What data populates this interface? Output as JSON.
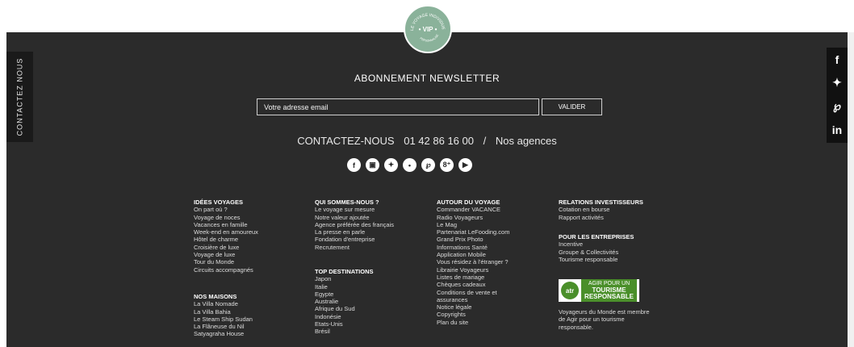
{
  "seal": {
    "arc_text": "LE VOYAGE INDIVIDUEL",
    "center": "• VIP •",
    "bottom_text": "PERSONNALISÉ"
  },
  "side_tab": {
    "label": "CONTACTEZ NOUS"
  },
  "social_bar": {
    "items": [
      {
        "glyph": "f",
        "icon": "facebook-icon"
      },
      {
        "glyph": "✦",
        "icon": "twitter-icon"
      },
      {
        "glyph": "℘",
        "icon": "pinterest-icon"
      },
      {
        "glyph": "in",
        "icon": "linkedin-icon"
      }
    ]
  },
  "newsletter": {
    "title": "ABONNEMENT NEWSLETTER",
    "placeholder": "Votre adresse email",
    "button": "VALIDER"
  },
  "contact": {
    "label": "CONTACTEZ-NOUS",
    "phone": "01 42 86 16 00",
    "separator": "/",
    "agencies": "Nos agences"
  },
  "social_icons": [
    {
      "glyph": "f",
      "icon": "facebook-icon"
    },
    {
      "glyph": "▣",
      "icon": "instagram-icon"
    },
    {
      "glyph": "✦",
      "icon": "twitter-icon"
    },
    {
      "glyph": "•",
      "icon": "podcast-icon"
    },
    {
      "glyph": "℘",
      "icon": "pinterest-icon"
    },
    {
      "glyph": "8⁺",
      "icon": "google-plus-icon"
    },
    {
      "glyph": "▶",
      "icon": "youtube-icon"
    }
  ],
  "columns": {
    "idees": {
      "title": "IDÉES VOYAGES",
      "items": [
        "On part où ?",
        "Voyage de noces",
        "Vacances en famille",
        "Week-end en amoureux",
        "Hôtel de charme",
        "Croisière de luxe",
        "Voyage de luxe",
        "Tour du Monde",
        "Circuits accompagnés"
      ]
    },
    "maisons": {
      "title": "NOS MAISONS",
      "items": [
        "La Villa Nomade",
        "La Villa Bahia",
        "Le Steam Ship Sudan",
        "La Flâneuse du Nil",
        "Satyagraha House"
      ]
    },
    "qui": {
      "title": "QUI SOMMES-NOUS ?",
      "items": [
        "Le voyage sur mesure",
        "Notre valeur ajoutée",
        "Agence préférée des français",
        "La presse en parle",
        "Fondation d'entreprise",
        "Recrutement"
      ]
    },
    "top": {
      "title": "TOP DESTINATIONS",
      "items": [
        "Japon",
        "Italie",
        "Egypte",
        "Australie",
        "Afrique du Sud",
        "Indonésie",
        "Etats-Unis",
        "Brésil"
      ]
    },
    "autour": {
      "title": "AUTOUR DU VOYAGE",
      "items": [
        "Commander VACANCE",
        "Radio Voyageurs",
        "Le Mag",
        "Partenariat LeFooding.com",
        "Grand Prix Photo",
        "Informations Santé",
        "Application Mobile",
        "Vous résidez à l'étranger ?",
        "Librairie Voyageurs",
        "Listes de mariage",
        "Chèques cadeaux",
        "Conditions de vente et",
        "assurances",
        "Notice légale",
        "Copyrights",
        "Plan du site"
      ]
    },
    "relations": {
      "title": "RELATIONS INVESTISSEURS",
      "items": [
        "Cotation en bourse",
        "Rapport activités"
      ]
    },
    "entreprises": {
      "title": "POUR LES ENTREPRISES",
      "items": [
        "Incentive",
        "Groupe & Collectivités",
        "Tourisme responsable"
      ]
    }
  },
  "atr": {
    "logo": "atr",
    "line1": "AGIR POUR UN",
    "line2": "TOURISME",
    "line3": "RESPONSABLE",
    "description": [
      "Voyageurs du Monde est membre",
      "de Agir pour un tourisme",
      "responsable."
    ]
  }
}
